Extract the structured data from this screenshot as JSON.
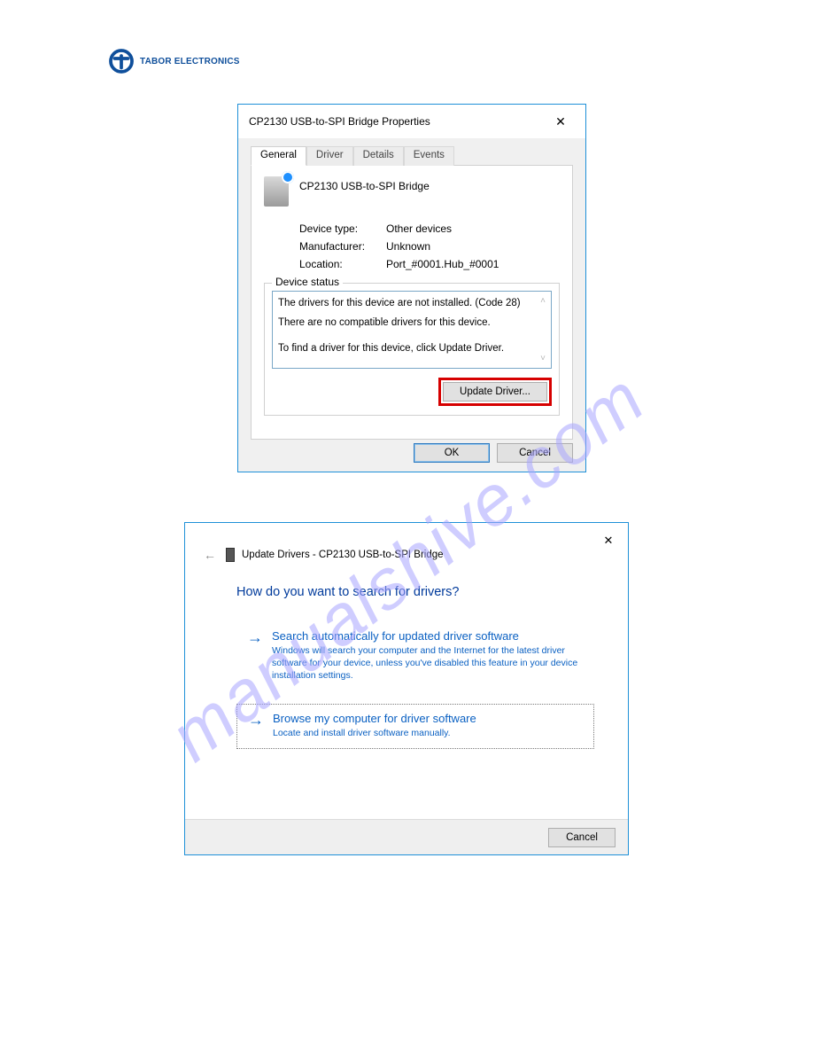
{
  "logo": {
    "brand_text": "TABOR ELECTRONICS"
  },
  "watermark": "manualshive.com",
  "dialog1": {
    "title": "CP2130 USB-to-SPI Bridge Properties",
    "tabs": [
      "General",
      "Driver",
      "Details",
      "Events"
    ],
    "active_tab_index": 0,
    "device_name": "CP2130 USB-to-SPI Bridge",
    "props": {
      "device_type_label": "Device type:",
      "device_type_value": "Other devices",
      "manufacturer_label": "Manufacturer:",
      "manufacturer_value": "Unknown",
      "location_label": "Location:",
      "location_value": "Port_#0001.Hub_#0001"
    },
    "status_legend": "Device status",
    "status_line1": "The drivers for this device are not installed. (Code 28)",
    "status_line2": "There are no compatible drivers for this device.",
    "status_line3": "To find a driver for this device, click Update Driver.",
    "update_driver_label": "Update Driver...",
    "ok_label": "OK",
    "cancel_label": "Cancel"
  },
  "dialog2": {
    "header": "Update Drivers - CP2130 USB-to-SPI Bridge",
    "question": "How do you want to search for drivers?",
    "option1": {
      "title": "Search automatically for updated driver software",
      "desc": "Windows will search your computer and the Internet for the latest driver software for your device, unless you've disabled this feature in your device installation settings."
    },
    "option2": {
      "title": "Browse my computer for driver software",
      "desc": "Locate and install driver software manually."
    },
    "cancel_label": "Cancel"
  }
}
